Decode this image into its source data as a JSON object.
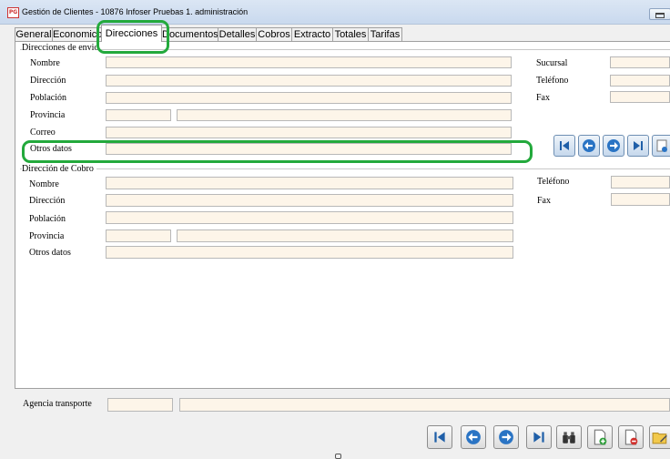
{
  "window": {
    "title": "Gestión de Clientes - 10876 Infoser Pruebas 1. administración",
    "icon_text": "PG"
  },
  "tabs": [
    {
      "label": "General"
    },
    {
      "label": "Economico"
    },
    {
      "label": "Direcciones"
    },
    {
      "label": "Documentos"
    },
    {
      "label": "Detalles"
    },
    {
      "label": "Cobros"
    },
    {
      "label": "Extracto"
    },
    {
      "label": "Totales"
    },
    {
      "label": "Tarifas"
    }
  ],
  "active_tab": "Direcciones",
  "envio": {
    "title": "Direcciones de envio",
    "nombre": "Nombre",
    "direccion": "Dirección",
    "poblacion": "Población",
    "provincia": "Provincia",
    "correo": "Correo",
    "otros": "Otros datos",
    "sucursal": "Sucursal",
    "telefono": "Teléfono",
    "fax": "Fax"
  },
  "cobro": {
    "title": "Dirección de Cobro",
    "nombre": "Nombre",
    "direccion": "Dirección",
    "poblacion": "Población",
    "provincia": "Provincia",
    "otros": "Otros datos",
    "telefono": "Teléfono",
    "fax": "Fax"
  },
  "agencia": {
    "label": "Agencia transporte"
  },
  "icons": {
    "nav": [
      "first-record-icon",
      "previous-record-icon",
      "next-record-icon",
      "last-record-icon",
      "add-address-icon"
    ],
    "bottom": [
      "first-icon",
      "previous-icon",
      "next-icon",
      "last-icon",
      "search-binoculars-icon",
      "new-document-icon",
      "delete-document-icon",
      "edit-folder-icon"
    ]
  },
  "colors": {
    "field_bg": "#fdf5e9",
    "highlight": "#23a93c",
    "nav_arrow": "#1f5fa8"
  }
}
